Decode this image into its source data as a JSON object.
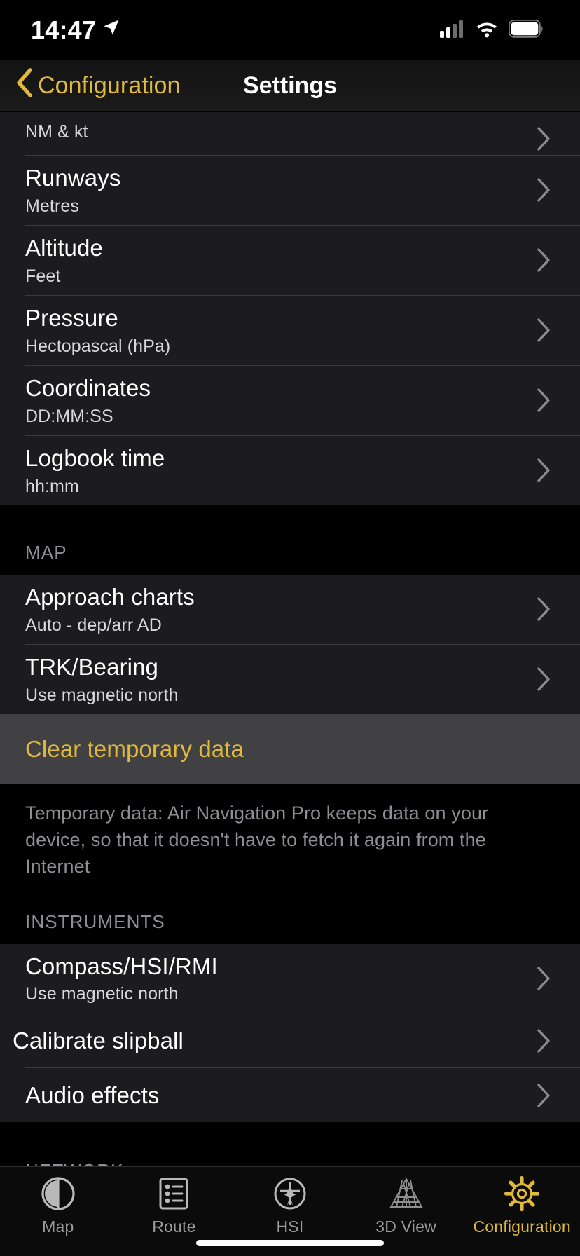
{
  "status_bar": {
    "time": "14:47",
    "location_icon": "location-arrow-icon",
    "cellular_icon": "cellular-bars-icon",
    "wifi_icon": "wifi-icon",
    "battery_icon": "battery-full-icon"
  },
  "nav_bar": {
    "back_label": "Configuration",
    "back_icon": "chevron-left-icon",
    "title": "Settings"
  },
  "colors": {
    "accent": "#e0b93c",
    "row_bg": "#1c1c1e",
    "highlight_bg": "#414143",
    "page_bg": "#000000",
    "separator": "#3a3a3c",
    "secondary_text": "#8e8e93"
  },
  "sections": [
    {
      "header": "",
      "rows": [
        {
          "title": "",
          "subtitle": "NM & kt",
          "clipped": true,
          "chevron": "chevron-right-icon"
        },
        {
          "title": "Runways",
          "subtitle": "Metres",
          "chevron": "chevron-right-icon"
        },
        {
          "title": "Altitude",
          "subtitle": "Feet",
          "chevron": "chevron-right-icon"
        },
        {
          "title": "Pressure",
          "subtitle": "Hectopascal (hPa)",
          "chevron": "chevron-right-icon"
        },
        {
          "title": "Coordinates",
          "subtitle": "DD:MM:SS",
          "chevron": "chevron-right-icon"
        },
        {
          "title": "Logbook time",
          "subtitle": "hh:mm",
          "chevron": "chevron-right-icon"
        }
      ]
    },
    {
      "header": "MAP",
      "rows": [
        {
          "title": "Approach charts",
          "subtitle": "Auto - dep/arr AD",
          "chevron": "chevron-right-icon"
        },
        {
          "title": "TRK/Bearing",
          "subtitle": "Use magnetic north",
          "chevron": "chevron-right-icon"
        },
        {
          "title": "Clear temporary data",
          "subtitle": "",
          "highlight": true,
          "chevron": ""
        }
      ],
      "footnote": "Temporary data: Air Navigation Pro keeps data on your device, so that it doesn't have to fetch it again from the Internet"
    },
    {
      "header": "INSTRUMENTS",
      "rows": [
        {
          "title": "Compass/HSI/RMI",
          "subtitle": "Use magnetic north",
          "chevron": "chevron-right-icon"
        },
        {
          "title": "Calibrate slipball",
          "subtitle": "",
          "noindent": true,
          "chevron": "chevron-right-icon"
        },
        {
          "title": "Audio effects",
          "subtitle": "",
          "chevron": "chevron-right-icon"
        }
      ]
    },
    {
      "header": "NETWORK",
      "rows": []
    }
  ],
  "tab_bar": {
    "items": [
      {
        "label": "Map",
        "icon": "map-circle-icon",
        "active": false
      },
      {
        "label": "Route",
        "icon": "route-list-icon",
        "active": false
      },
      {
        "label": "HSI",
        "icon": "hsi-compass-icon",
        "active": false
      },
      {
        "label": "3D View",
        "icon": "terrain-mesh-icon",
        "active": false
      },
      {
        "label": "Configuration",
        "icon": "gear-icon",
        "active": true
      }
    ]
  }
}
